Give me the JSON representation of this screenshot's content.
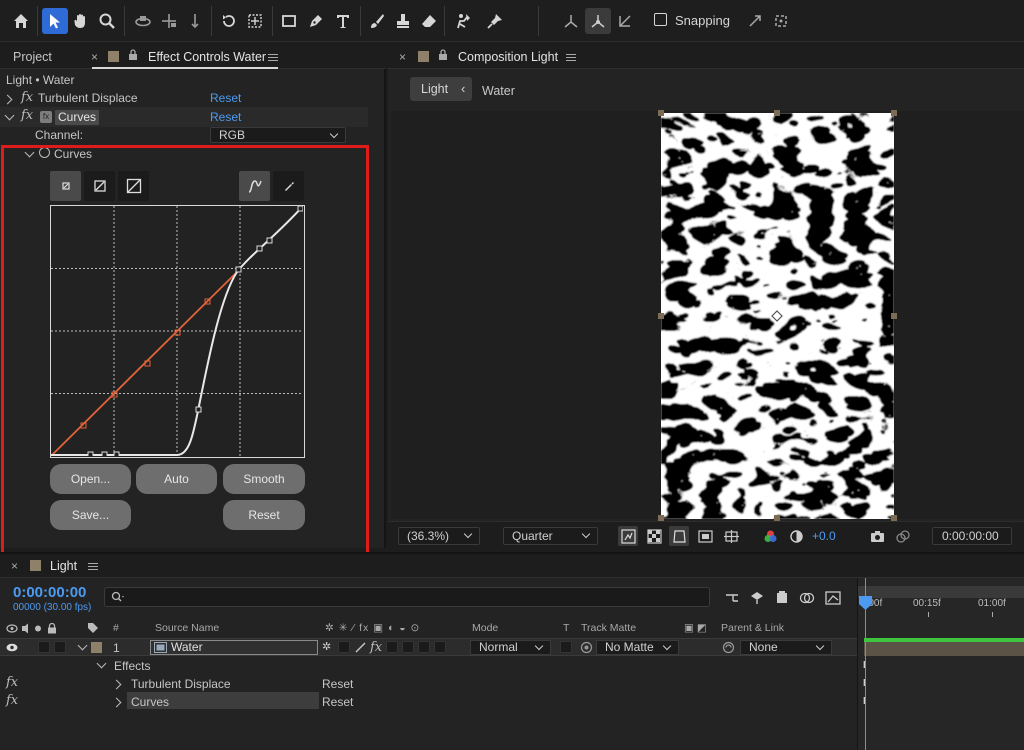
{
  "toolbar": {
    "snapping_label": "Snapping",
    "icons": [
      "home-icon",
      "selection-tool-icon",
      "hand-tool-icon",
      "zoom-tool-icon",
      "orbit-camera-icon",
      "pan-camera-icon",
      "dolly-camera-icon",
      "rotate-tool-icon",
      "pan-behind-icon",
      "rectangle-tool-icon",
      "pen-tool-icon",
      "type-tool-icon",
      "brush-tool-icon",
      "clone-stamp-icon",
      "eraser-icon",
      "roto-brush-icon",
      "puppet-pin-icon",
      "local-axis-icon",
      "world-axis-icon",
      "view-axis-icon"
    ]
  },
  "left_panel": {
    "tab_project": "Project",
    "tab_effect_controls": "Effect Controls Water",
    "layer_path": "Light • Water",
    "effects": [
      {
        "name": "Turbulent Displace",
        "reset": "Reset"
      },
      {
        "name": "Curves",
        "reset": "Reset"
      }
    ],
    "channel_label": "Channel:",
    "channel_value": "RGB",
    "curves_label": "Curves",
    "buttons": {
      "open": "Open...",
      "auto": "Auto",
      "smooth": "Smooth",
      "save": "Save...",
      "reset": "Reset"
    }
  },
  "composition": {
    "tab_title": "Composition Light",
    "breadcrumb_light": "Light",
    "breadcrumb_water": "Water",
    "zoom": "(36.3%)",
    "resolution": "Quarter",
    "exposure": "+0.0",
    "timecode": "0:00:00:00"
  },
  "timeline": {
    "tab_title": "Light",
    "timecode": "0:00:00:00",
    "fps": "00000 (30.00 fps)",
    "columns": {
      "number": "#",
      "source_name": "Source Name",
      "mode": "Mode",
      "t": "T",
      "track_matte": "Track Matte",
      "parent_link": "Parent & Link"
    },
    "layer": {
      "number": "1",
      "name": "Water",
      "mode": "Normal",
      "track_matte": "No Matte",
      "parent": "None"
    },
    "effects_group": "Effects",
    "effect_rows": [
      {
        "name": "Turbulent Displace",
        "reset": "Reset"
      },
      {
        "name": "Curves",
        "reset": "Reset"
      }
    ],
    "ruler": [
      "0:00f",
      "00:15f",
      "01:00f"
    ]
  },
  "colors": {
    "accent_blue": "#4d9bf0",
    "highlight_red": "#e01b1b",
    "curve_orange": "#e0633a",
    "work_area_green": "#3ec43e"
  }
}
